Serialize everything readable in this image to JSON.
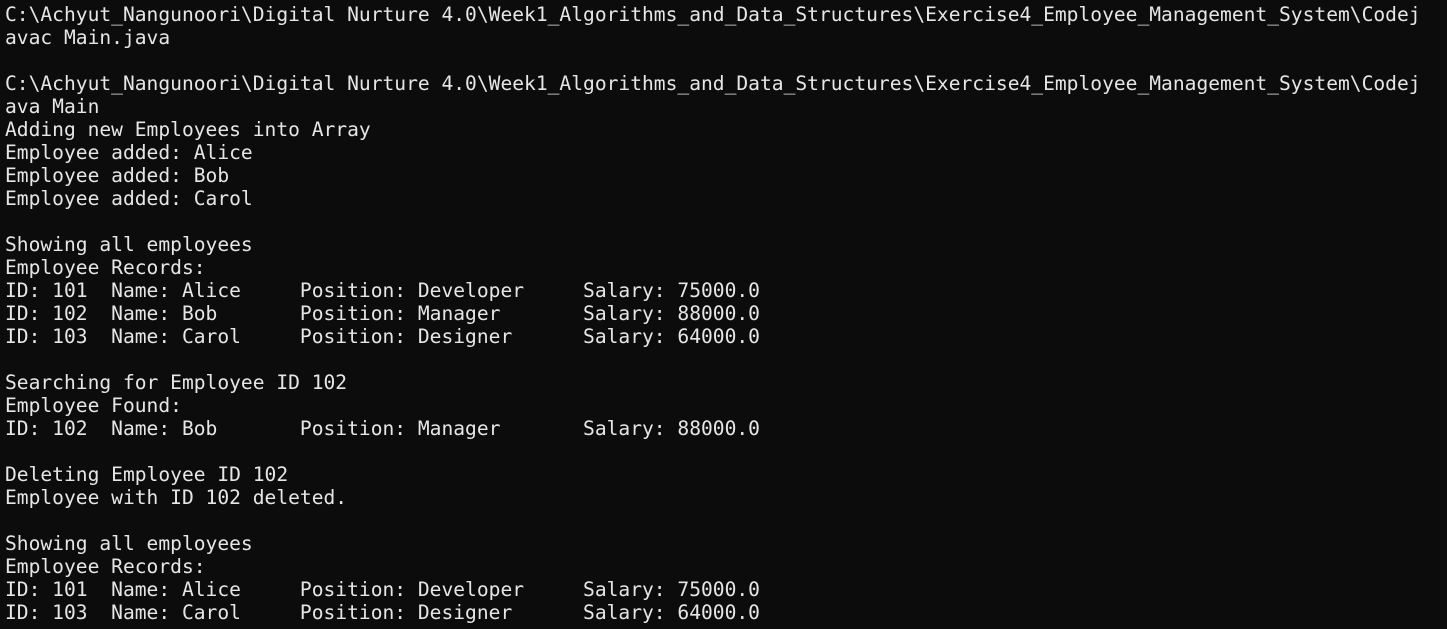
{
  "terminal": {
    "background": "#0c0c0c",
    "foreground": "#e6e6e6",
    "lines": [
      "C:\\Achyut_Nangunoori\\Digital Nurture 4.0\\Week1_Algorithms_and_Data_Structures\\Exercise4_Employee_Management_System\\Codej",
      "avac Main.java",
      "",
      "C:\\Achyut_Nangunoori\\Digital Nurture 4.0\\Week1_Algorithms_and_Data_Structures\\Exercise4_Employee_Management_System\\Codej",
      "ava Main",
      "Adding new Employees into Array",
      "Employee added: Alice",
      "Employee added: Bob",
      "Employee added: Carol",
      "",
      "Showing all employees",
      "Employee Records:",
      "ID: 101  Name: Alice     Position: Developer     Salary: 75000.0",
      "ID: 102  Name: Bob       Position: Manager       Salary: 88000.0",
      "ID: 103  Name: Carol     Position: Designer      Salary: 64000.0",
      "",
      "Searching for Employee ID 102",
      "Employee Found:",
      "ID: 102  Name: Bob       Position: Manager       Salary: 88000.0",
      "",
      "Deleting Employee ID 102",
      "Employee with ID 102 deleted.",
      "",
      "Showing all employees",
      "Employee Records:",
      "ID: 101  Name: Alice     Position: Developer     Salary: 75000.0",
      "ID: 103  Name: Carol     Position: Designer      Salary: 64000.0"
    ]
  }
}
